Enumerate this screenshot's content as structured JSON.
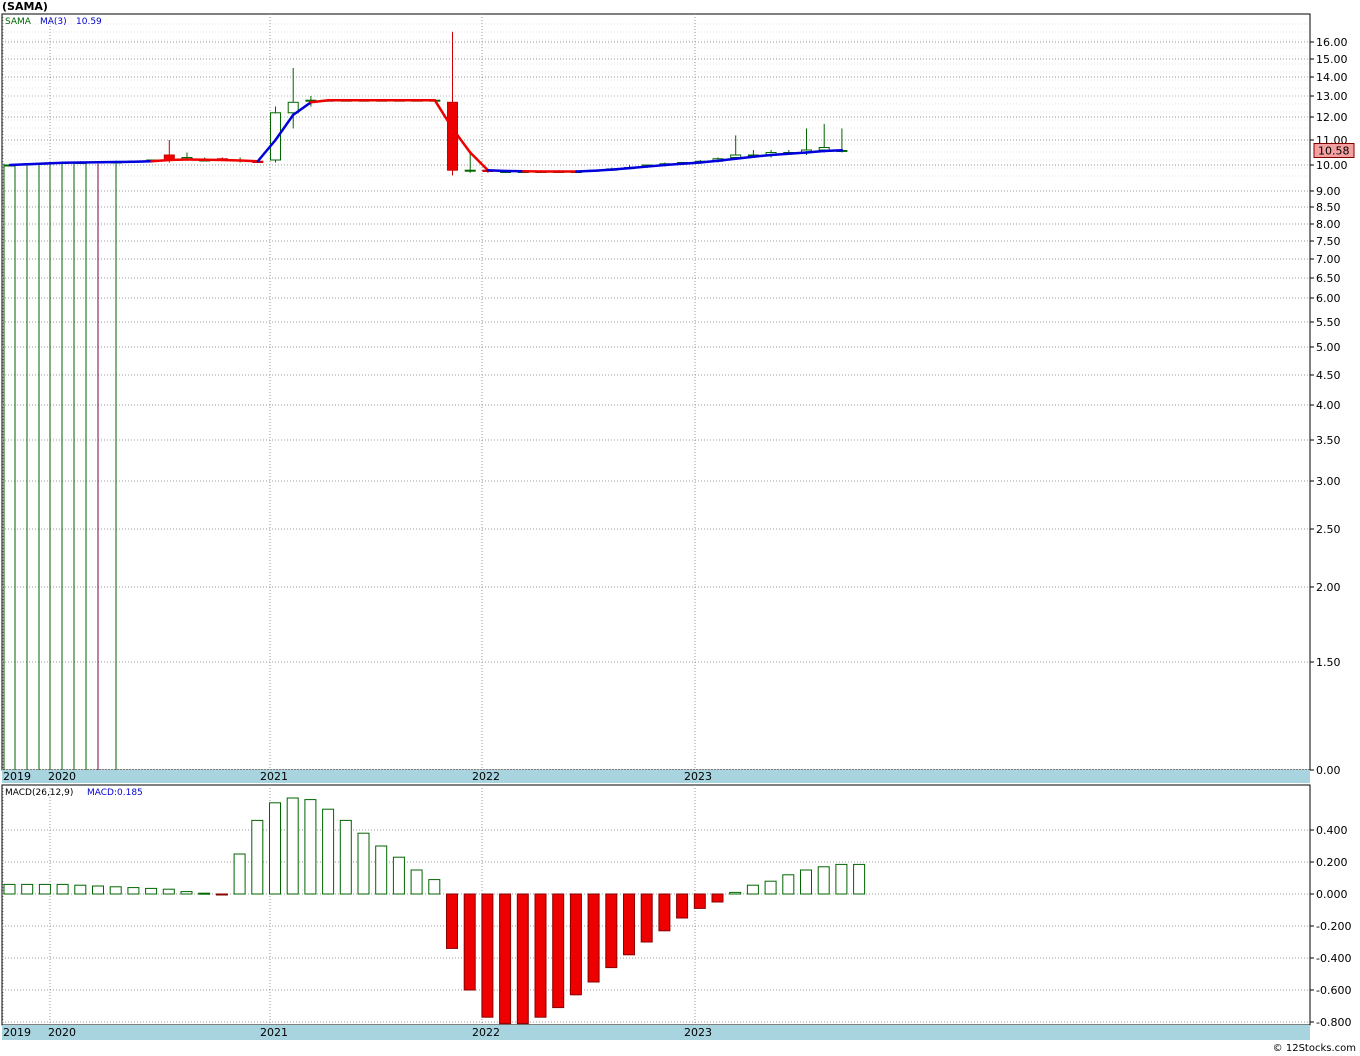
{
  "title": "(SAMA)",
  "copyright": "© 12Stocks.com",
  "price_panel": {
    "legend": {
      "symbol": "SAMA",
      "ma_label": "MA(3)",
      "ma_value": "10.59"
    },
    "last_price_label": "10.58",
    "y_ticks": [
      {
        "v": 16,
        "label": "16.00"
      },
      {
        "v": 15,
        "label": "15.00"
      },
      {
        "v": 14,
        "label": "14.00"
      },
      {
        "v": 13,
        "label": "13.00"
      },
      {
        "v": 12,
        "label": "12.00"
      },
      {
        "v": 11,
        "label": "11.00"
      },
      {
        "v": 10,
        "label": "10.00"
      },
      {
        "v": 9,
        "label": "9.00"
      },
      {
        "v": 8.5,
        "label": "8.50"
      },
      {
        "v": 8,
        "label": "8.00"
      },
      {
        "v": 7.5,
        "label": "7.50"
      },
      {
        "v": 7,
        "label": "7.00"
      },
      {
        "v": 6.5,
        "label": "6.50"
      },
      {
        "v": 6,
        "label": "6.00"
      },
      {
        "v": 5.5,
        "label": "5.50"
      },
      {
        "v": 5,
        "label": "5.00"
      },
      {
        "v": 4.5,
        "label": "4.50"
      },
      {
        "v": 4,
        "label": "4.00"
      },
      {
        "v": 3.5,
        "label": "3.50"
      },
      {
        "v": 3,
        "label": "3.00"
      },
      {
        "v": 2.5,
        "label": "2.50"
      },
      {
        "v": 2,
        "label": "2.00"
      },
      {
        "v": 1.5,
        "label": "1.50"
      },
      {
        "v": 0,
        "label": "0.00"
      }
    ],
    "x_labels": [
      "2019",
      "2020",
      "2021",
      "2022",
      "2023"
    ]
  },
  "macd_panel": {
    "legend": {
      "label": "MACD(26,12,9)",
      "value_label": "MACD:0.185"
    },
    "y_ticks": [
      {
        "v": 0.4,
        "label": "0.400"
      },
      {
        "v": 0.2,
        "label": "0.200"
      },
      {
        "v": 0,
        "label": "0.000"
      },
      {
        "v": -0.2,
        "label": "-0.200"
      },
      {
        "v": -0.4,
        "label": "-0.400"
      },
      {
        "v": -0.6,
        "label": "-0.600"
      },
      {
        "v": -0.8,
        "label": "-0.800"
      }
    ],
    "x_labels": [
      "2019",
      "2020",
      "2021",
      "2022",
      "2023"
    ]
  },
  "chart_data": [
    {
      "type": "candlestick",
      "scale": "log",
      "ylim": [
        0,
        16.5
      ],
      "ohlc": [
        [
          10.0,
          10.0,
          0,
          10.0
        ],
        [
          10.05,
          10.05,
          0,
          10.05
        ],
        [
          10.08,
          10.08,
          0,
          10.08
        ],
        [
          10.1,
          10.1,
          0,
          10.1
        ],
        [
          10.1,
          10.1,
          0,
          10.1
        ],
        [
          10.12,
          10.25,
          0,
          10.12
        ],
        [
          10.12,
          10.12,
          0,
          10.12
        ],
        [
          10.15,
          10.15,
          10.1,
          10.15
        ],
        [
          10.2,
          10.2,
          10.15,
          10.2
        ],
        [
          10.4,
          11.0,
          10.1,
          10.2
        ],
        [
          10.25,
          10.5,
          10.2,
          10.3
        ],
        [
          10.2,
          10.3,
          10.15,
          10.2
        ],
        [
          10.25,
          10.3,
          10.2,
          10.2
        ],
        [
          10.2,
          10.3,
          10.1,
          10.2
        ],
        [
          10.15,
          10.2,
          10.1,
          10.1
        ],
        [
          10.2,
          12.5,
          10.1,
          12.2
        ],
        [
          12.2,
          14.5,
          11.5,
          12.7
        ],
        [
          12.8,
          13.0,
          12.5,
          12.8
        ],
        [
          12.8,
          12.8,
          12.8,
          12.8
        ],
        [
          12.8,
          12.8,
          12.8,
          12.8
        ],
        [
          12.8,
          12.8,
          12.8,
          12.8
        ],
        [
          12.8,
          12.8,
          12.8,
          12.8
        ],
        [
          12.8,
          12.8,
          12.8,
          12.8
        ],
        [
          12.8,
          12.8,
          12.8,
          12.8
        ],
        [
          12.8,
          12.8,
          12.8,
          12.8
        ],
        [
          12.7,
          16.6,
          9.6,
          9.8
        ],
        [
          9.8,
          10.5,
          9.7,
          9.8
        ],
        [
          9.8,
          9.8,
          9.7,
          9.75
        ],
        [
          9.75,
          9.8,
          9.7,
          9.75
        ],
        [
          9.75,
          9.8,
          9.7,
          9.75
        ],
        [
          9.75,
          9.8,
          9.7,
          9.75
        ],
        [
          9.75,
          9.8,
          9.7,
          9.75
        ],
        [
          9.75,
          9.8,
          9.7,
          9.75
        ],
        [
          9.8,
          9.8,
          9.75,
          9.8
        ],
        [
          9.8,
          9.9,
          9.8,
          9.85
        ],
        [
          9.9,
          10.0,
          9.85,
          9.9
        ],
        [
          9.95,
          10.0,
          9.9,
          10.0
        ],
        [
          10.0,
          10.1,
          9.95,
          10.05
        ],
        [
          10.05,
          10.1,
          10.0,
          10.1
        ],
        [
          10.1,
          10.2,
          10.05,
          10.15
        ],
        [
          10.15,
          10.3,
          10.1,
          10.25
        ],
        [
          10.3,
          11.2,
          10.2,
          10.4
        ],
        [
          10.4,
          10.6,
          10.3,
          10.4
        ],
        [
          10.4,
          10.6,
          10.3,
          10.5
        ],
        [
          10.5,
          10.6,
          10.4,
          10.5
        ],
        [
          10.5,
          11.5,
          10.4,
          10.6
        ],
        [
          10.6,
          11.7,
          10.5,
          10.7
        ],
        [
          10.58,
          11.5,
          10.5,
          10.58
        ]
      ],
      "ma3": [
        10.0,
        10.03,
        10.06,
        10.09,
        10.1,
        10.11,
        10.12,
        10.13,
        10.15,
        10.2,
        10.22,
        10.21,
        10.2,
        10.18,
        10.15,
        11.0,
        12.1,
        12.7,
        12.8,
        12.8,
        12.8,
        12.8,
        12.8,
        12.8,
        12.8,
        11.5,
        10.5,
        9.8,
        9.77,
        9.76,
        9.75,
        9.75,
        9.75,
        9.78,
        9.82,
        9.88,
        9.94,
        10.0,
        10.05,
        10.1,
        10.17,
        10.25,
        10.33,
        10.4,
        10.45,
        10.5,
        10.56,
        10.59
      ],
      "ma3_rising": [
        true,
        true,
        true,
        true,
        true,
        true,
        true,
        true,
        true,
        false,
        false,
        false,
        false,
        false,
        false,
        true,
        true,
        true,
        false,
        false,
        false,
        false,
        false,
        false,
        false,
        false,
        false,
        false,
        true,
        true,
        false,
        false,
        false,
        true,
        true,
        true,
        true,
        true,
        true,
        true,
        true,
        true,
        true,
        true,
        true,
        true,
        true,
        true
      ]
    },
    {
      "type": "bar",
      "title": "MACD(26,12,9)",
      "ylim": [
        -0.8,
        0.55
      ],
      "values": [
        0.06,
        0.06,
        0.06,
        0.06,
        0.055,
        0.05,
        0.045,
        0.04,
        0.035,
        0.03,
        0.015,
        0.005,
        -0.005,
        0.25,
        0.46,
        0.57,
        0.6,
        0.59,
        0.53,
        0.46,
        0.38,
        0.3,
        0.23,
        0.15,
        0.09,
        -0.34,
        -0.6,
        -0.77,
        -0.81,
        -0.81,
        -0.77,
        -0.71,
        -0.63,
        -0.55,
        -0.46,
        -0.38,
        -0.3,
        -0.23,
        -0.15,
        -0.09,
        -0.05,
        0.01,
        0.055,
        0.08,
        0.12,
        0.15,
        0.17,
        0.185,
        0.185
      ]
    }
  ]
}
